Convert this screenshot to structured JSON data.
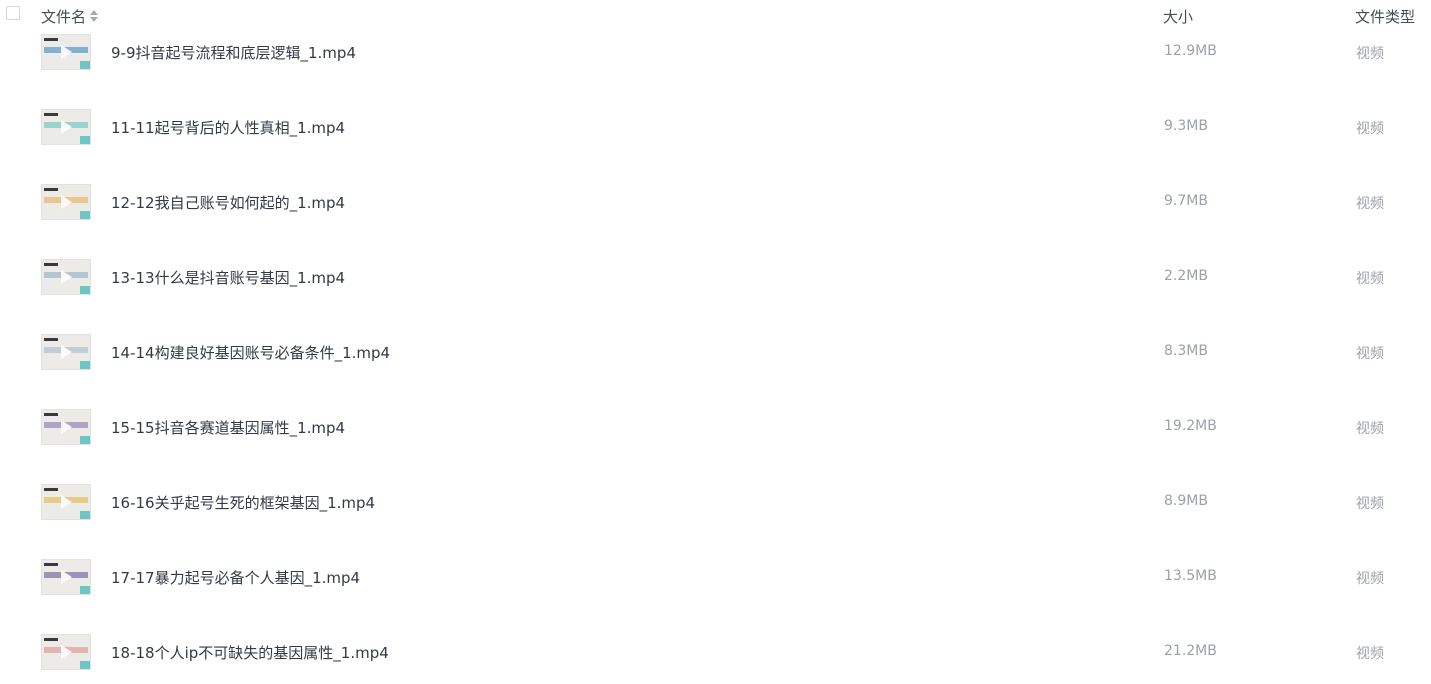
{
  "header": {
    "name_label": "文件名",
    "size_label": "大小",
    "type_label": "文件类型"
  },
  "files": [
    {
      "name": "9-9抖音起号流程和底层逻辑_1.mp4",
      "size": "12.9MB",
      "type": "视频",
      "thumb_accent": "#2f7fc1"
    },
    {
      "name": "11-11起号背后的人性真相_1.mp4",
      "size": "9.3MB",
      "type": "视频",
      "thumb_accent": "#5bbfb8"
    },
    {
      "name": "12-12我自己账号如何起的_1.mp4",
      "size": "9.7MB",
      "type": "视频",
      "thumb_accent": "#e7a84a"
    },
    {
      "name": "13-13什么是抖音账号基因_1.mp4",
      "size": "2.2MB",
      "type": "视频",
      "thumb_accent": "#8aa6c2"
    },
    {
      "name": "14-14构建良好基因账号必备条件_1.mp4",
      "size": "8.3MB",
      "type": "视频",
      "thumb_accent": "#9fb3c6"
    },
    {
      "name": "15-15抖音各赛道基因属性_1.mp4",
      "size": "19.2MB",
      "type": "视频",
      "thumb_accent": "#7b6aa8"
    },
    {
      "name": "16-16关乎起号生死的框架基因_1.mp4",
      "size": "8.9MB",
      "type": "视频",
      "thumb_accent": "#e0b33a"
    },
    {
      "name": "17-17暴力起号必备个人基因_1.mp4",
      "size": "13.5MB",
      "type": "视频",
      "thumb_accent": "#5a4e8c"
    },
    {
      "name": "18-18个人ip不可缺失的基因属性_1.mp4",
      "size": "21.2MB",
      "type": "视频",
      "thumb_accent": "#d98a86"
    }
  ]
}
